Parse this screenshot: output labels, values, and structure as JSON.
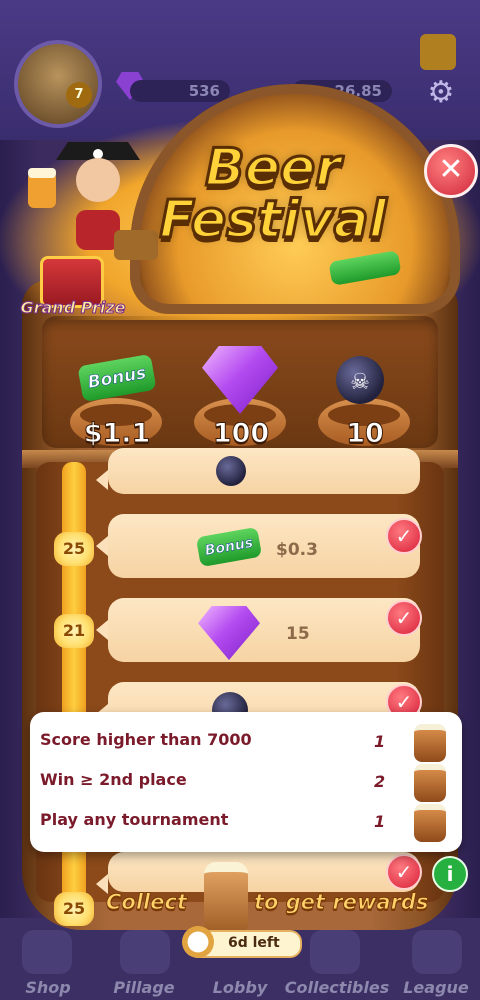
{
  "background": {
    "currency_a": "536",
    "currency_b": "26.85",
    "level": "7",
    "nav": [
      "Shop",
      "Pillage",
      "Lobby",
      "Collectibles",
      "League"
    ]
  },
  "event": {
    "title_line1": "Beer",
    "title_line2": "Festival",
    "grand_prize_label": "Grand Prize",
    "close_icon": "close-icon"
  },
  "grand_rewards": [
    {
      "icon": "bonus-cash-icon",
      "icon_text": "Bonus",
      "value": "$1.1"
    },
    {
      "icon": "gem-icon",
      "value": "100"
    },
    {
      "icon": "bomb-icon",
      "value": "10"
    }
  ],
  "milestones": [
    {
      "level": "25",
      "icon": "bonus-cash-icon",
      "icon_text": "Bonus",
      "value": "$0.3"
    },
    {
      "level": "21",
      "icon": "gem-icon",
      "value": "15"
    }
  ],
  "tasks": [
    {
      "name": "Score higher than 7000",
      "count": "1"
    },
    {
      "name": "Win ≥ 2nd place",
      "count": "2"
    },
    {
      "name": "Play any tournament",
      "count": "1"
    }
  ],
  "footer": {
    "current_level": "25",
    "collect_text": "Collect",
    "collect_suffix": "to get rewards",
    "time_left": "6d left"
  },
  "colors": {
    "accent_gold": "#ffd23a",
    "check_red": "#d8203a",
    "info_green": "#26b040"
  }
}
